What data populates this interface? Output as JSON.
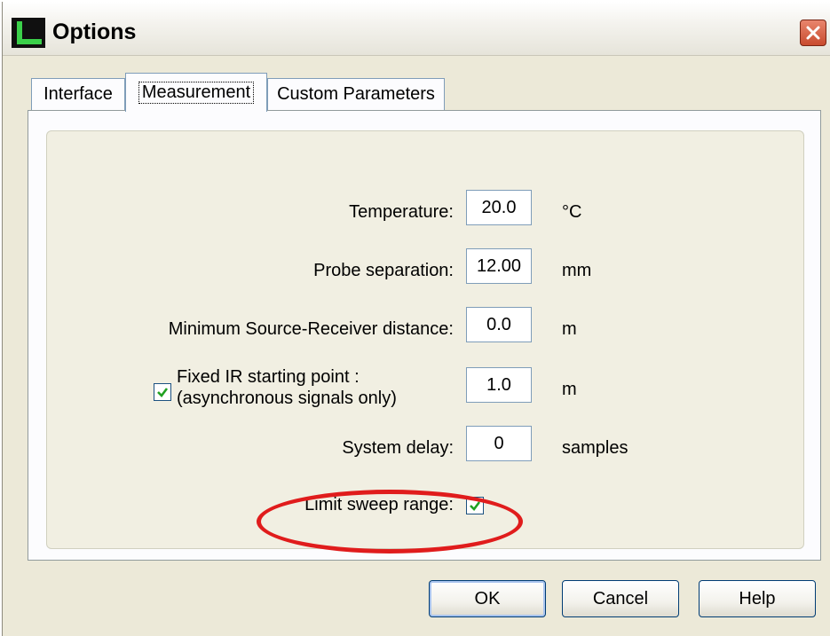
{
  "window": {
    "title": "Options",
    "icons": {
      "app": "app-icon",
      "close": "close-icon"
    }
  },
  "tabs": [
    {
      "label": "Interface",
      "selected": false
    },
    {
      "label": "Measurement",
      "selected": true
    },
    {
      "label": "Custom Parameters",
      "selected": false
    }
  ],
  "fields": {
    "temperature": {
      "label": "Temperature:",
      "value": "20.0",
      "unit": "°C"
    },
    "probe_separation": {
      "label": "Probe separation:",
      "value": "12.00",
      "unit": "mm"
    },
    "min_distance": {
      "label": "Minimum Source-Receiver distance:",
      "value": "0.0",
      "unit": "m"
    },
    "fixed_ir": {
      "label_line1": "Fixed IR starting point :",
      "label_line2": "(asynchronous signals only)",
      "checked": true,
      "value": "1.0",
      "unit": "m"
    },
    "system_delay": {
      "label": "System delay:",
      "value": "0",
      "unit": "samples"
    },
    "limit_sweep": {
      "label": "Limit sweep range:",
      "checked": true
    }
  },
  "annotation": {
    "color": "#e01c1c"
  },
  "buttons": {
    "ok": "OK",
    "cancel": "Cancel",
    "help": "Help"
  },
  "colors": {
    "dialog_bg": "#ece9d8",
    "panel_bg": "#fcfcfe",
    "check_green": "#21a121",
    "close_red": "#c84b2e"
  }
}
